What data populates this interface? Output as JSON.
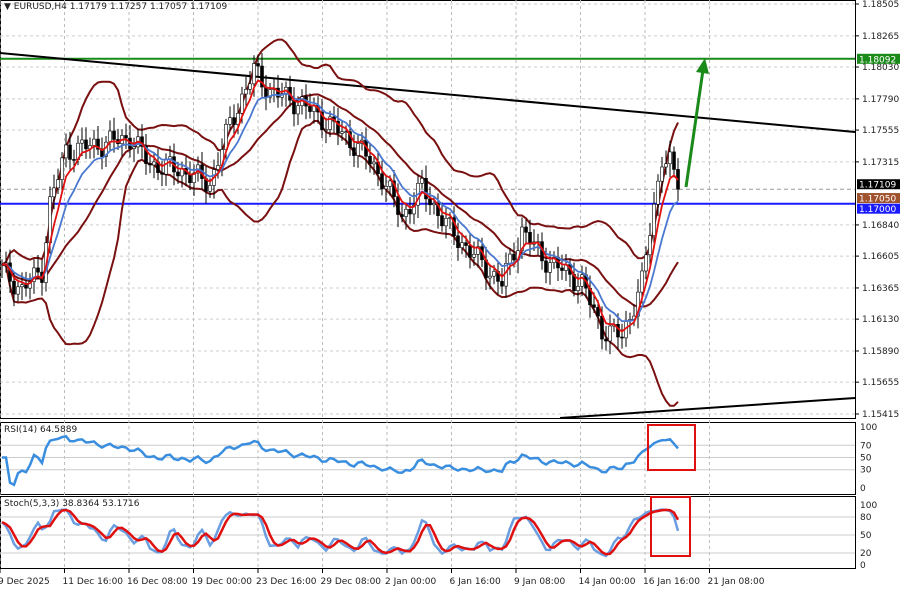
{
  "header": {
    "symbol": "EURUSD,H4",
    "ohlc": "1.17179 1.17257 1.17057 1.17109"
  },
  "rsi_header": {
    "label": "RSI(14)",
    "value": "64.5889"
  },
  "stoch_header": {
    "label": "Stoch(5,3,3)",
    "values": "38.8364 53.1716"
  },
  "price_axis": [
    "1.18505",
    "1.18265",
    "1.18030",
    "1.17790",
    "1.17555",
    "1.17315",
    "1.16840",
    "1.16605",
    "1.16365",
    "1.16130",
    "1.15890",
    "1.15655",
    "1.15415"
  ],
  "price_tags": [
    {
      "text": "1.18092",
      "color": "#1a8a1a"
    },
    {
      "text": "1.17109",
      "color": "#000000"
    },
    {
      "text": "1.17050",
      "color": "#a0522d"
    },
    {
      "text": "1.17000",
      "color": "#1a1aff"
    }
  ],
  "rsi_axis": [
    "100",
    "70",
    "50",
    "30",
    "0"
  ],
  "stoch_axis": [
    "100",
    "80",
    "50",
    "20",
    "0"
  ],
  "time_axis": [
    "9 Dec 2025",
    "11 Dec 16:00",
    "16 Dec 08:00",
    "19 Dec 00:00",
    "23 Dec 16:00",
    "29 Dec 08:00",
    "2 Jan 00:00",
    "6 Jan 16:00",
    "9 Jan 08:00",
    "14 Jan 00:00",
    "16 Jan 16:00",
    "21 Jan 08:00"
  ],
  "chart_data": {
    "type": "candlestick",
    "title": "EURUSD,H4",
    "ylim": [
      1.15415,
      1.18505
    ],
    "close_keypoints": [
      [
        0,
        1.165
      ],
      [
        5,
        1.1635
      ],
      [
        10,
        1.165
      ],
      [
        12,
        1.17
      ],
      [
        16,
        1.174
      ],
      [
        25,
        1.1745
      ],
      [
        32,
        1.175
      ],
      [
        37,
        1.173
      ],
      [
        45,
        1.1725
      ],
      [
        52,
        1.1715
      ],
      [
        57,
        1.176
      ],
      [
        63,
        1.18
      ],
      [
        67,
        1.1785
      ],
      [
        75,
        1.1775
      ],
      [
        82,
        1.176
      ],
      [
        90,
        1.174
      ],
      [
        95,
        1.172
      ],
      [
        100,
        1.169
      ],
      [
        105,
        1.1712
      ],
      [
        112,
        1.168
      ],
      [
        120,
        1.1655
      ],
      [
        125,
        1.164
      ],
      [
        130,
        1.168
      ],
      [
        135,
        1.166
      ],
      [
        140,
        1.165
      ],
      [
        145,
        1.164
      ],
      [
        150,
        1.1605
      ],
      [
        155,
        1.16
      ],
      [
        160,
        1.164
      ],
      [
        162,
        1.168
      ],
      [
        165,
        1.1735
      ],
      [
        167,
        1.173
      ],
      [
        169,
        1.17109
      ]
    ],
    "levels": {
      "resistance": 1.18092,
      "support": 1.17,
      "current": 1.17109
    },
    "indicators": [
      "Bollinger Bands(20,2)",
      "MA",
      "RSI(14)",
      "Stoch(5,3,3)"
    ]
  }
}
